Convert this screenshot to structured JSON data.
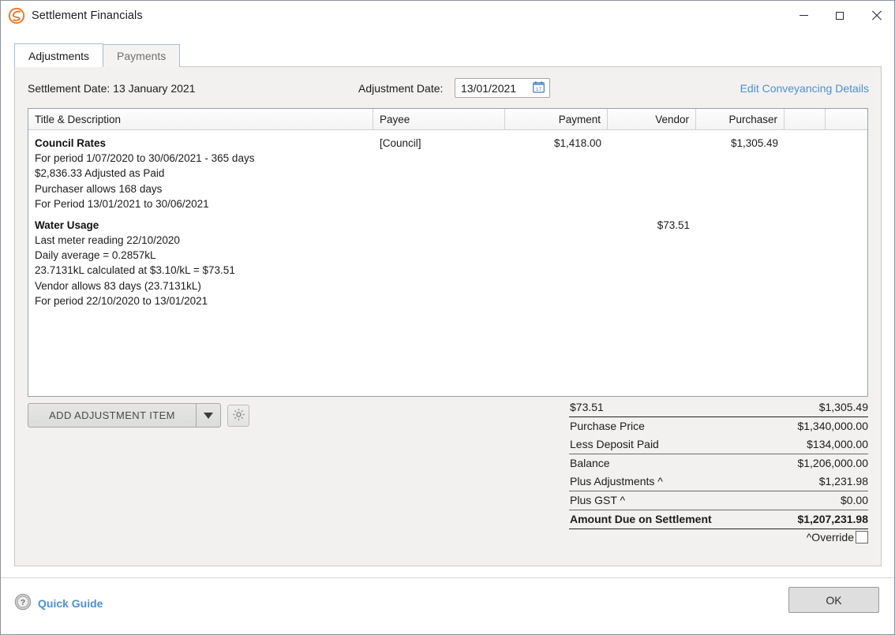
{
  "window": {
    "title": "Settlement Financials",
    "app_icon": "spiral-s-logo-icon",
    "accent_blue": "#4a90d9",
    "logo_orange": "#ef7622",
    "controls": {
      "minimize": "minimize-icon",
      "maximize": "maximize-icon",
      "close": "close-icon"
    }
  },
  "tabs": [
    {
      "label": "Adjustments",
      "active": true
    },
    {
      "label": "Payments",
      "active": false
    }
  ],
  "header": {
    "settlement_date": "Settlement Date: 13 January 2021",
    "adjustment_date_label": "Adjustment Date:",
    "adjustment_date_value": "13/01/2021",
    "adjustment_date_placeholder": "dd/mm/yyyy",
    "calendar_icon": "calendar-icon",
    "calendar_icon_day": "17",
    "edit_link": "Edit Conveyancing Details"
  },
  "grid": {
    "columns": [
      {
        "label": "Title & Description",
        "align": "left"
      },
      {
        "label": "Payee",
        "align": "left"
      },
      {
        "label": "Payment",
        "align": "right"
      },
      {
        "label": "Vendor",
        "align": "right"
      },
      {
        "label": "Purchaser",
        "align": "right"
      },
      {
        "label": "",
        "align": "left"
      },
      {
        "label": "",
        "align": "left"
      }
    ],
    "rows": [
      {
        "title": "Council Rates",
        "details": [
          "For period 1/07/2020 to 30/06/2021 - 365 days",
          "$2,836.33 Adjusted as Paid",
          "Purchaser allows 168 days",
          "For Period 13/01/2021 to 30/06/2021"
        ],
        "payee": "[Council]",
        "payment": "$1,418.00",
        "vendor": "",
        "purchaser": "$1,305.49"
      },
      {
        "title": "Water Usage",
        "details": [
          "Last meter reading 22/10/2020",
          "Daily average = 0.2857kL",
          "23.7131kL calculated at $3.10/kL = $73.51",
          "Vendor allows 83 days (23.7131kL)",
          "For period 22/10/2020 to 13/01/2021"
        ],
        "payee": "",
        "payment": "",
        "vendor": "$73.51",
        "purchaser": ""
      }
    ]
  },
  "actions": {
    "add_item_label": "ADD ADJUSTMENT ITEM",
    "dropdown_icon": "chevron-down-icon",
    "settings_icon": "gear-icon"
  },
  "totals": {
    "column_totals": {
      "vendor": "$73.51",
      "purchaser": "$1,305.49"
    },
    "rows": [
      {
        "label": "Purchase Price",
        "value": "$1,340,000.00"
      },
      {
        "label": "Less Deposit Paid",
        "value": "$134,000.00"
      },
      {
        "label": "Balance",
        "value": "$1,206,000.00"
      },
      {
        "label": "Plus Adjustments ^",
        "value": "$1,231.98"
      },
      {
        "label": "Plus GST ^",
        "value": "$0.00"
      }
    ],
    "grand": {
      "label": "Amount Due on Settlement",
      "value": "$1,207,231.98"
    },
    "override_label": "^Override",
    "override_checked": false
  },
  "footer": {
    "quick_guide": "Quick Guide",
    "help_icon": "question-mark-circle-icon",
    "ok_label": "OK"
  }
}
